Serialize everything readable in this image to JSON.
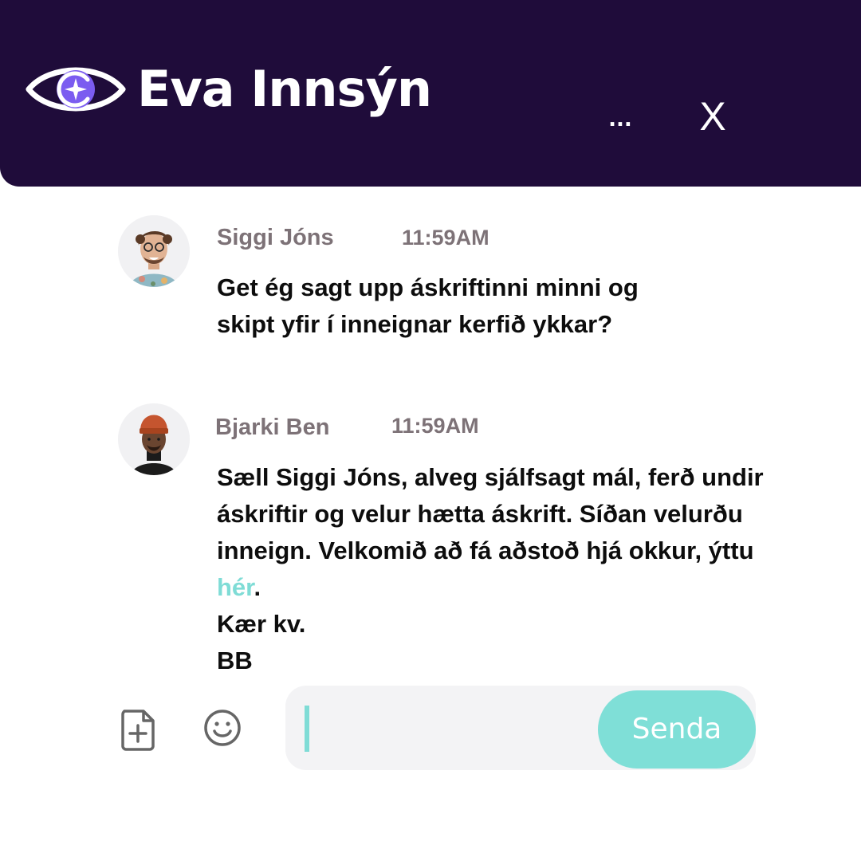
{
  "app": {
    "brand_name": "Eva Innsýn",
    "logo_icon": "eye-logo-icon",
    "more_label": "...",
    "close_label": "X"
  },
  "colors": {
    "header_bg": "#1f0c3a",
    "accent": "#7fdfd7",
    "logo_purple": "#7b5cf0",
    "meta_text": "#7d7277",
    "input_bg": "#f3f3f5"
  },
  "messages": [
    {
      "sender": "Siggi Jóns",
      "time": "11:59AM",
      "lines": [
        "Get ég sagt upp áskriftinni  minni og",
        "skipt yfir í inneignar kerfið ykkar?"
      ]
    },
    {
      "sender": "Bjarki Ben",
      "time": "11:59AM",
      "lines": [
        "Sæll Siggi Jóns, alveg sjálfsagt mál, ferð undir",
        "áskriftir og velur hætta áskrift. Síðan velurðu",
        "inneign. Velkomið að fá aðstoð hjá okkur, ýttu"
      ],
      "link_text": "hér",
      "link_suffix": ".",
      "closing_lines": [
        "Kær kv.",
        "BB"
      ]
    }
  ],
  "composer": {
    "input_value": "",
    "attach_icon": "file-add-icon",
    "emoji_icon": "smiley-icon",
    "send_label": "Senda"
  }
}
